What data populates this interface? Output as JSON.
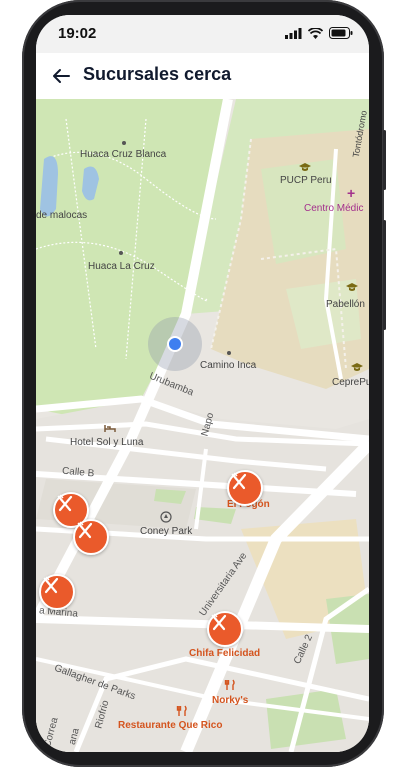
{
  "status_bar": {
    "time": "19:02"
  },
  "header": {
    "title": "Sucursales cerca"
  },
  "map": {
    "places": {
      "huaca_cruz_blanca": "Huaca Cruz Blanca",
      "malocas": "de malocas",
      "huaca_la_cruz": "Huaca La Cruz",
      "pucp": "PUCP Peru",
      "centro_medico": "Centro Médic",
      "pabellon": "Pabellón",
      "camino_inca": "Camino Inca",
      "cepre": "CeprePu",
      "hotel": "Hotel Sol y Luna",
      "coney_park": "Coney Park",
      "norkys": "Norky's",
      "restaurante": "Restaurante Que Rico",
      "tontodromo": "Tontódromo"
    },
    "streets": {
      "urubamba": "Urubamba",
      "napo": "Napo",
      "calle_b": "Calle B",
      "universitaria": "Universitaria Ave",
      "marina": "a Marina",
      "gallagher": "Gallagher de Parks",
      "riofrio": "Riofrio",
      "calle2": "Calle 2",
      "correa": "Correa",
      "ana": "ana"
    },
    "restaurants": {
      "el_fogon": "El Fogón",
      "chifa": "Chifa Felicidad"
    },
    "colors": {
      "park": "#cfe6b4",
      "campus": "#e8dcbc",
      "road": "#ffffff",
      "pin": "#ea5a2b",
      "user": "#3f7ff0"
    }
  }
}
